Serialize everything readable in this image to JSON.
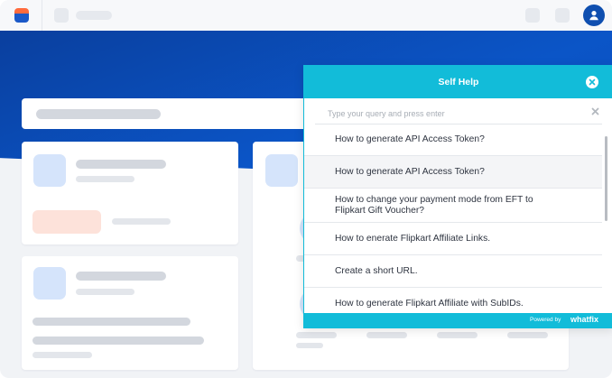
{
  "widget": {
    "title": "Self Help",
    "search_placeholder": "Type your query and press enter",
    "results": [
      {
        "label": "How to generate API Access Token?"
      },
      {
        "label": "How to generate API Access Token?"
      },
      {
        "label": "How to change your payment mode from EFT to Flipkart Gift Voucher?"
      },
      {
        "label": "How to enerate Flipkart Affiliate Links."
      },
      {
        "label": "Create a short URL."
      },
      {
        "label": "How to generate Flipkart Affiliate with SubIDs."
      }
    ],
    "footer": {
      "powered_by": "Powered by",
      "brand": "whatfix"
    }
  },
  "icons": {
    "app_logo": "app-logo-icon",
    "avatar": "user-avatar-icon",
    "close": "close-icon",
    "clear": "clear-icon"
  },
  "colors": {
    "accent": "#12bcd9",
    "hero_blue": "#0b55c7",
    "avatar": "#0f4fb0"
  }
}
